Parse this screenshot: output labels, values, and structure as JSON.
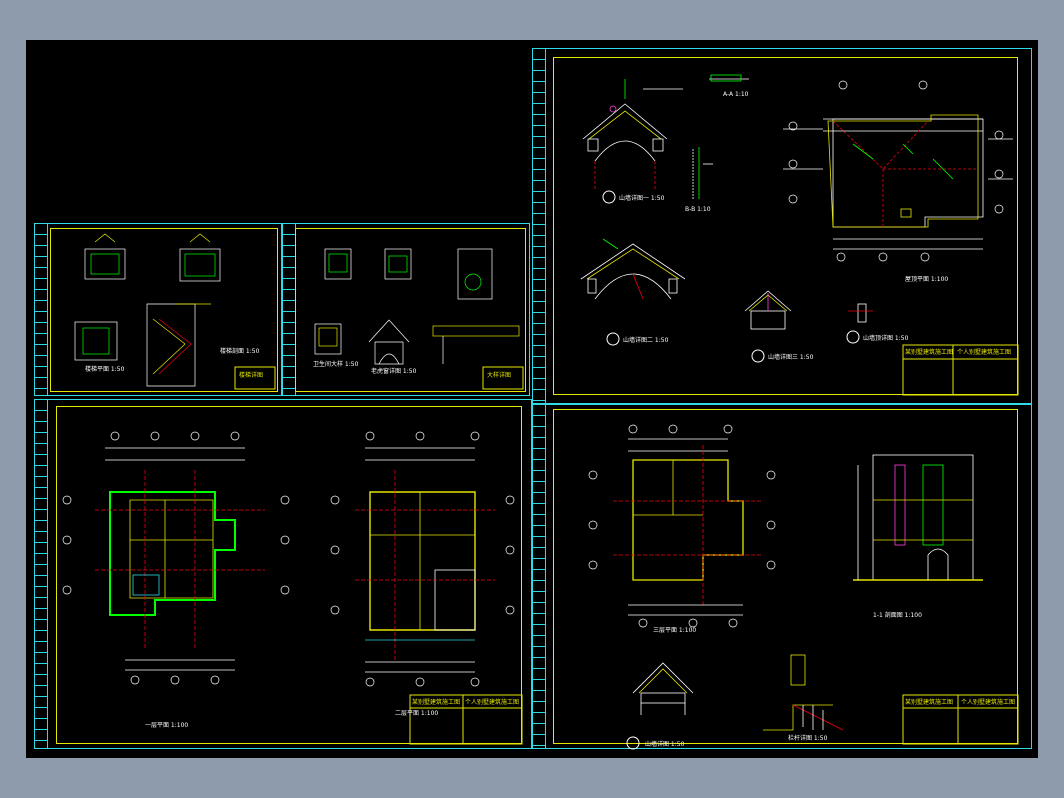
{
  "app": {
    "background": "#000000",
    "frame_color": "#2fd9e6",
    "border_color": "#e6e600"
  },
  "sheets": {
    "top_right": {
      "labels": {
        "detail1": "山墙详图一 1:50",
        "detail2": "山墙详图二 1:50",
        "detail3": "山墙详图三 1:50",
        "detail4": "山墙顶详图 1:50",
        "roof_plan": "屋顶平面 1:100",
        "section_a": "A-A 1:10",
        "section_b": "B-B 1:10"
      },
      "titleblock": {
        "left": "某别墅建筑施工图",
        "right": "个人别墅建筑施工图"
      }
    },
    "mid_left": {
      "labels": {
        "stair_plan": "楼梯平面 1:50",
        "stair_section": "楼梯剖面 1:50"
      },
      "titleblock": "楼梯详图"
    },
    "mid_center": {
      "labels": {
        "bath_plan": "卫生间大样 1:50",
        "window_detail": "老虎窗详图 1:50"
      },
      "titleblock": "大样详图"
    },
    "bottom_left": {
      "labels": {
        "first_floor": "一层平面 1:100",
        "second_floor": "二层平面 1:100"
      },
      "titleblock": {
        "left": "某别墅建筑施工图",
        "right": "个人别墅建筑施工图"
      }
    },
    "bottom_right": {
      "labels": {
        "third_floor": "三层平面 1:100",
        "section_11": "1-1 剖面图 1:100",
        "gable": "山墙详图 1:50",
        "rail": "栏杆详图 1:50"
      },
      "titleblock": {
        "left": "某别墅建筑施工图",
        "right": "个人别墅建筑施工图"
      }
    }
  }
}
